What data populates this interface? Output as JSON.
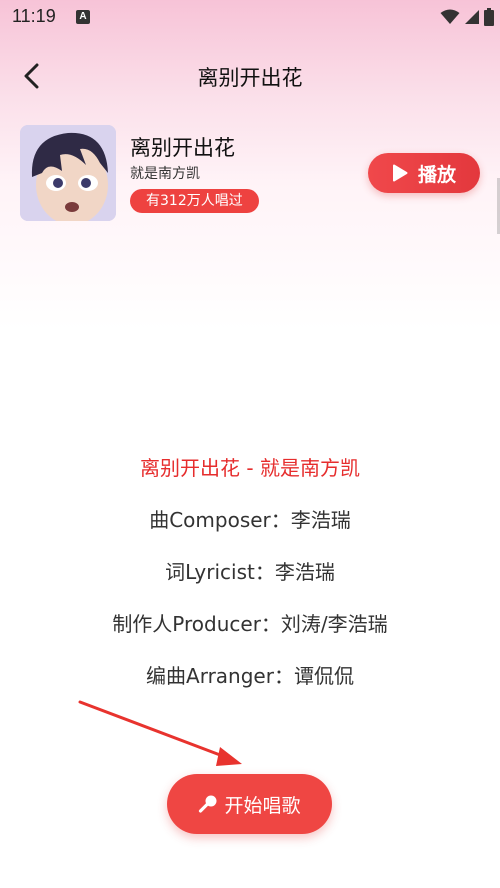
{
  "status_bar": {
    "time": "11:19",
    "notification_icon": "A"
  },
  "header": {
    "title": "离别开出花",
    "back_icon": "chevron-left-icon"
  },
  "song": {
    "title": "离别开出花",
    "artist": "就是南方凯",
    "sung_count": "有312万人唱过",
    "play_label": "播放"
  },
  "lyrics": [
    "离别开出花 - 就是南方凯",
    "曲Composer：李浩瑞",
    "词Lyricist：李浩瑞",
    "制作人Producer：刘涛/李浩瑞",
    "编曲Arranger：谭侃侃"
  ],
  "start_button": {
    "label": "开始唱歌",
    "icon": "microphone-icon"
  },
  "colors": {
    "accent": "#ee4240",
    "active_lyric": "#e62d2d",
    "header_gradient": "#f7c3d7"
  }
}
